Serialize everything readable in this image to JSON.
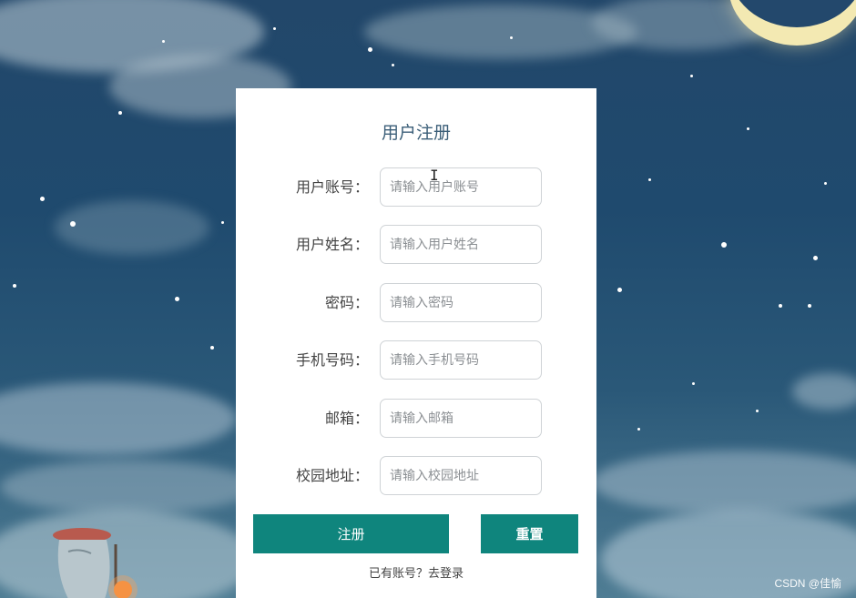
{
  "form": {
    "title": "用户注册",
    "fields": [
      {
        "label": "用户账号：",
        "placeholder": "请输入用户账号",
        "value": ""
      },
      {
        "label": "用户姓名：",
        "placeholder": "请输入用户姓名",
        "value": ""
      },
      {
        "label": "密码：",
        "placeholder": "请输入密码",
        "value": ""
      },
      {
        "label": "手机号码：",
        "placeholder": "请输入手机号码",
        "value": ""
      },
      {
        "label": "邮箱：",
        "placeholder": "请输入邮箱",
        "value": ""
      },
      {
        "label": "校园地址：",
        "placeholder": "请输入校园地址",
        "value": ""
      }
    ],
    "register_label": "注册",
    "reset_label": "重置",
    "login_link": "已有账号？去登录"
  },
  "watermark": "CSDN @佳愉",
  "colors": {
    "button": "#0f857d",
    "card": "#ffffff",
    "title": "#3b5e78",
    "sky": "#22476a"
  },
  "icons": {
    "cursor": "text-cursor-icon"
  }
}
